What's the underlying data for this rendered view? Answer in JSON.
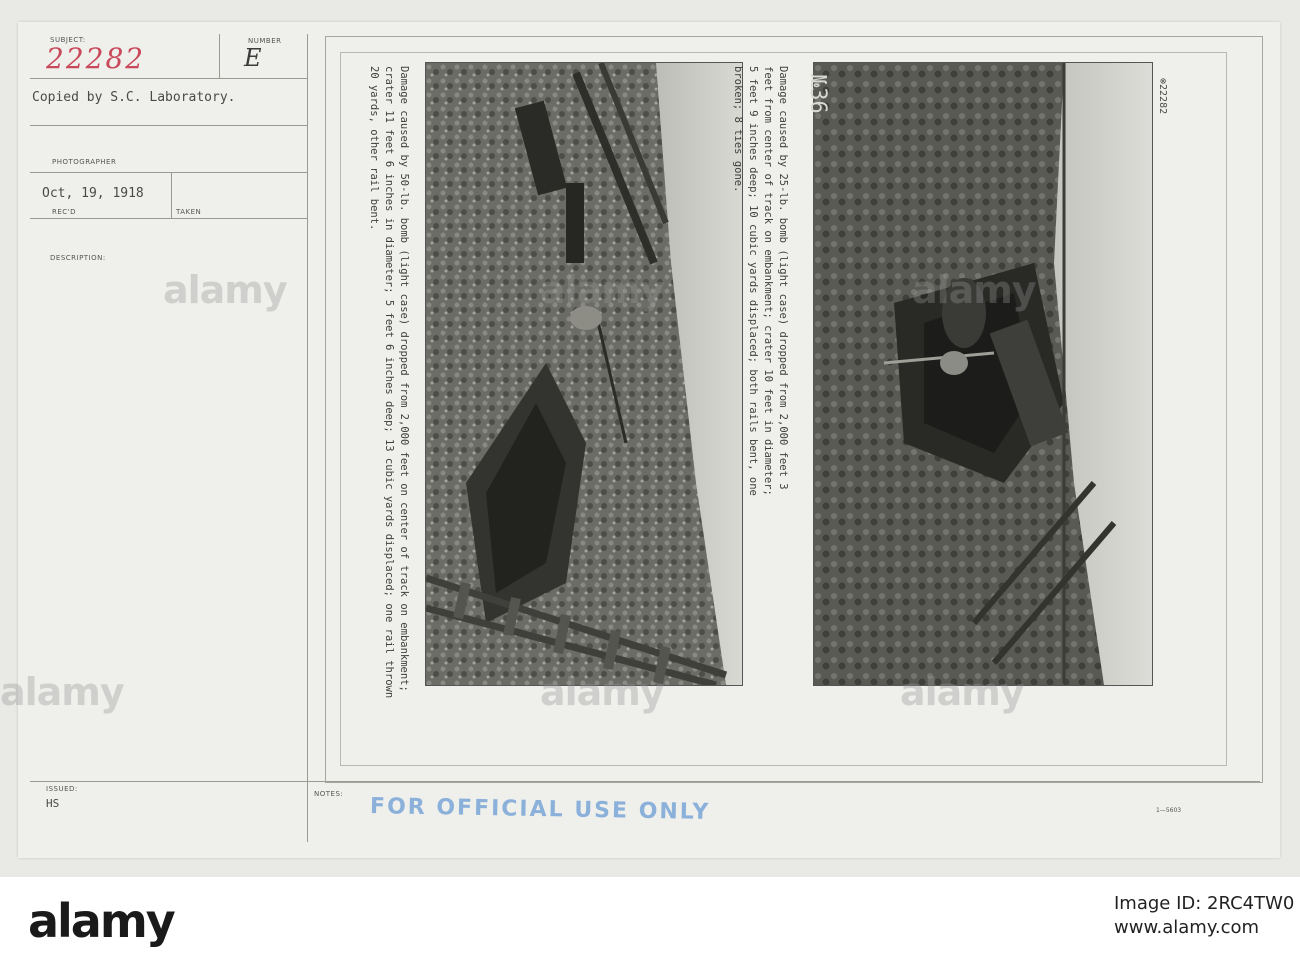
{
  "form": {
    "subject_label": "SUBJECT:",
    "number_label": "NUMBER",
    "subject_number": "22282",
    "number_letter": "E",
    "copied_by": "Copied by S.C. Laboratory.",
    "photographer_label": "PHOTOGRAPHER",
    "date": "Oct, 19, 1918",
    "recd_label": "REC'D",
    "taken_label": "TAKEN",
    "description_label": "DESCRIPTION:",
    "issued_label": "ISSUED:",
    "issued_value": "HS",
    "notes_label": "NOTES:",
    "stamp": "FOR OFFICIAL USE ONLY",
    "form_number": "1—5603"
  },
  "photos": {
    "right_caption": "Damage caused by 25-lb. bomb (light case) dropped from 2,000 feet 3 feet from center of track on embankment; crater 10 feet in diameter; 5 feet 9 inches deep; 10 cubic yards displaced; both rails bent, one broken; 8 ties gone.",
    "right_plate_number": "№36",
    "right_serial": "⊗22282",
    "left_caption": "Damage caused by 50-lb. bomb (light case) dropped from 2,000 feet on center of track on embankment; crater 11 feet 6 inches in diameter; 5 feet 6 inches deep; 13 cubic yards displaced; one rail thrown 20 yards, other rail bent."
  },
  "watermark": "alamy",
  "footer": {
    "logo": "alamy",
    "image_id": "Image ID: 2RC4TW0",
    "url": "www.alamy.com"
  }
}
